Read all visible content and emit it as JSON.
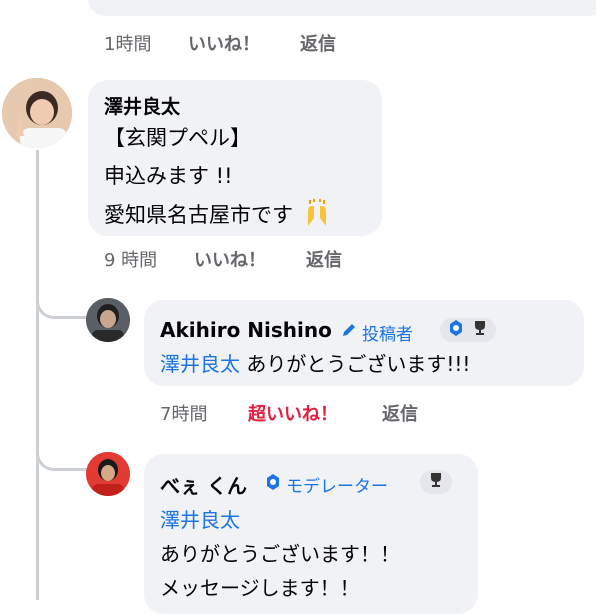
{
  "top": {
    "time": "1時間",
    "like": "いいね！",
    "reply": "返信"
  },
  "comment1": {
    "author": "澤井良太",
    "lines": [
      "【玄関プペル】",
      "申込みます !!",
      "愛知県名古屋市です"
    ],
    "time": "9 時間",
    "like": "いいね！",
    "reply": "返信"
  },
  "reply1": {
    "author": "Akihiro Nishino",
    "badge": "投稿者",
    "mention": "澤井良太",
    "text": " ありがとうございます!!!",
    "time": "7時間",
    "like": "超いいね！",
    "reply": "返信",
    "like_color": "#e41e3f"
  },
  "reply2": {
    "author": "べぇ くん",
    "badge": "モデレーター",
    "mention": "澤井良太",
    "lines": [
      "ありがとうございます！！",
      "メッセージします！！"
    ]
  },
  "colors": {
    "bubble": "#f0f2f5",
    "link": "#1b74e4",
    "meta": "#65676b"
  }
}
